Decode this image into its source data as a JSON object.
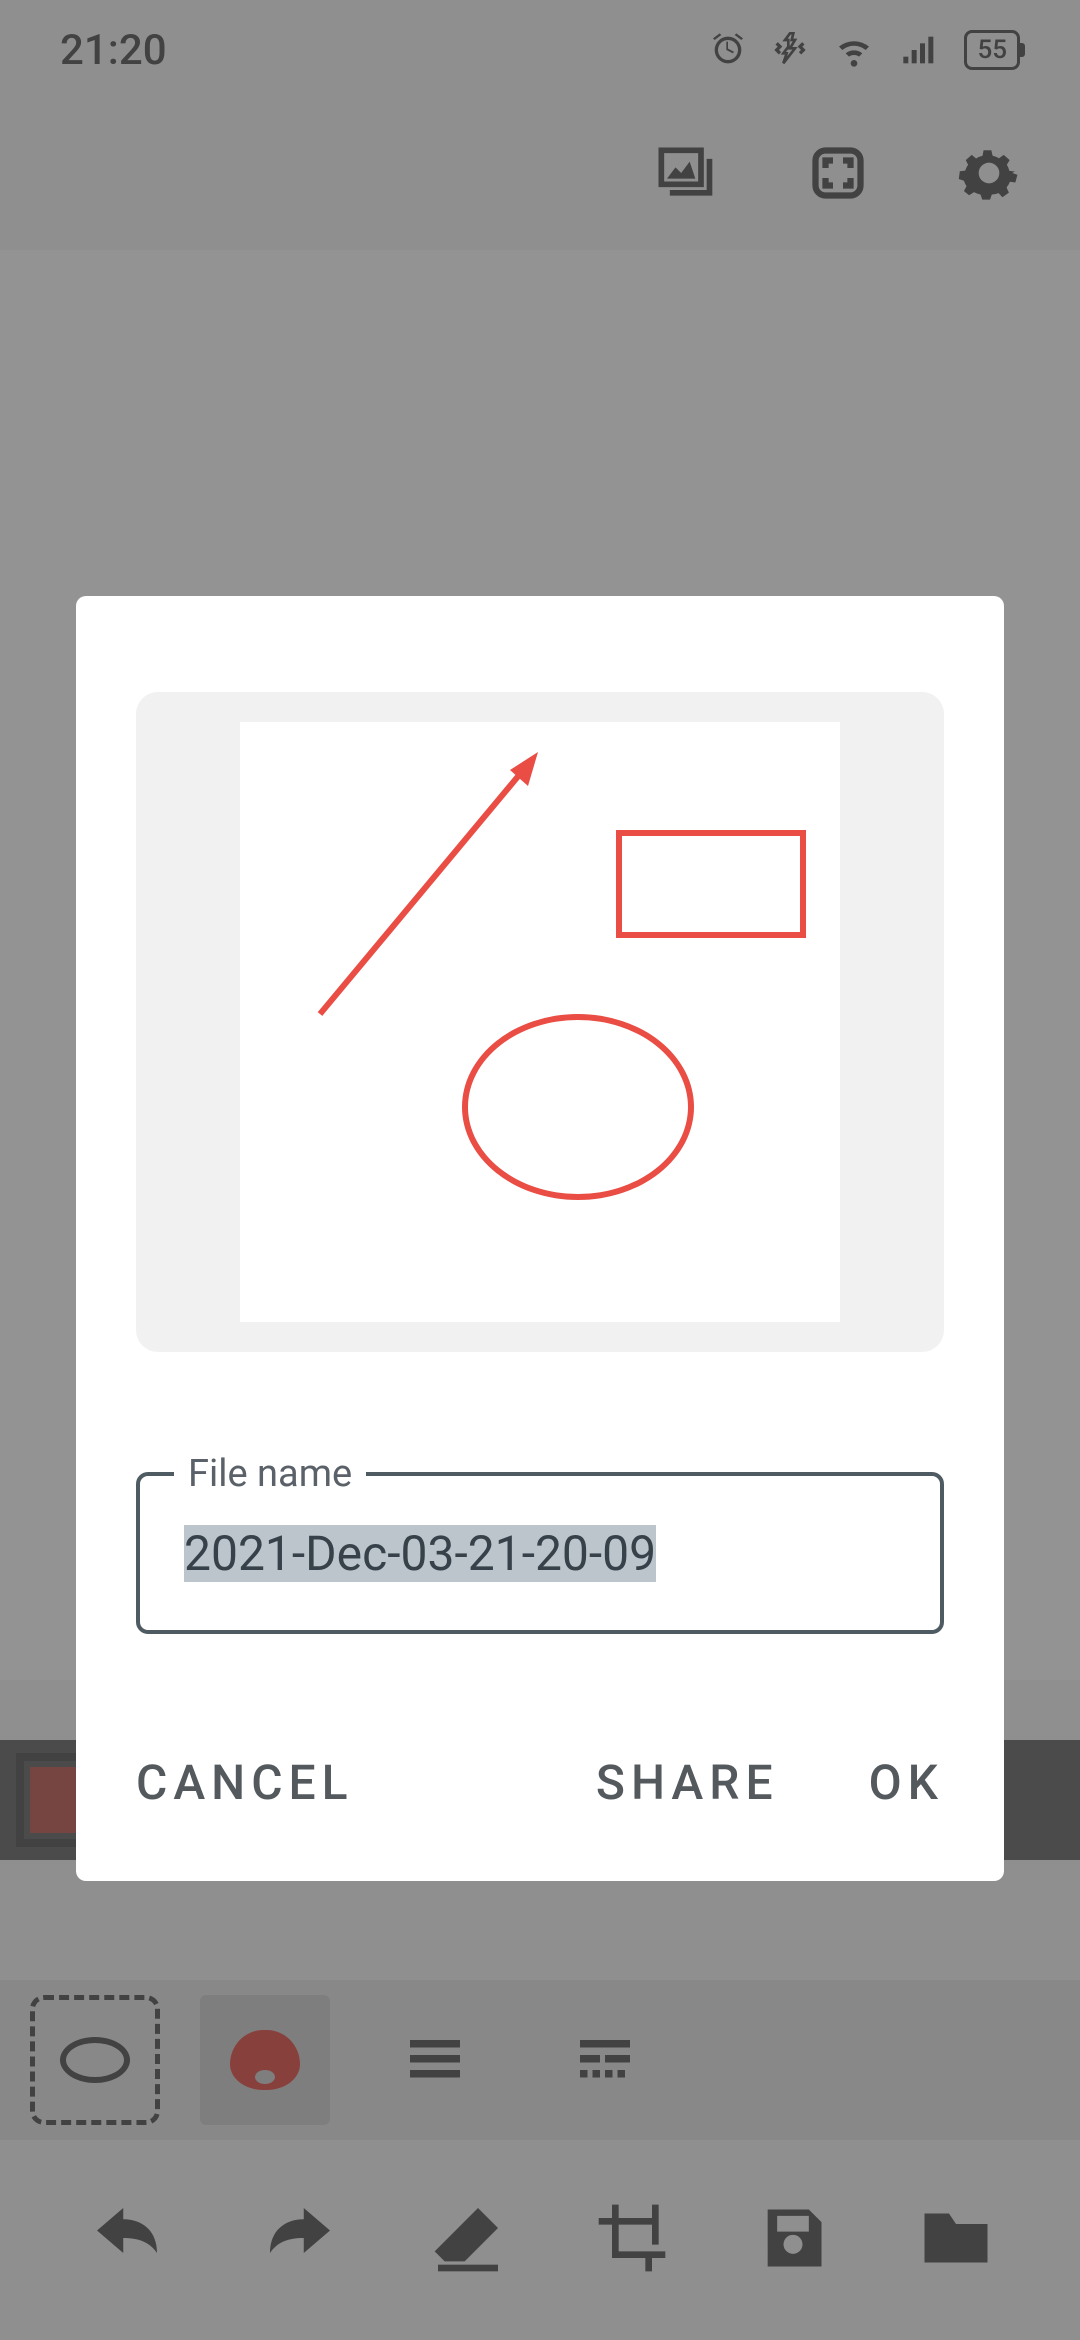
{
  "status_bar": {
    "time": "21:20",
    "battery": "55"
  },
  "dialog": {
    "field_label": "File name",
    "file_name": "2021-Dec-03-21-20-09",
    "cancel": "CANCEL",
    "share": "SHARE",
    "ok": "OK"
  },
  "colors": {
    "selected": "#b23028",
    "palette": [
      "#b23028",
      "#0a8e4a",
      "#1451c7",
      "#f4d30b",
      "#7321c9",
      "#da5ea1",
      "#000000",
      "#bdbdbd"
    ]
  }
}
